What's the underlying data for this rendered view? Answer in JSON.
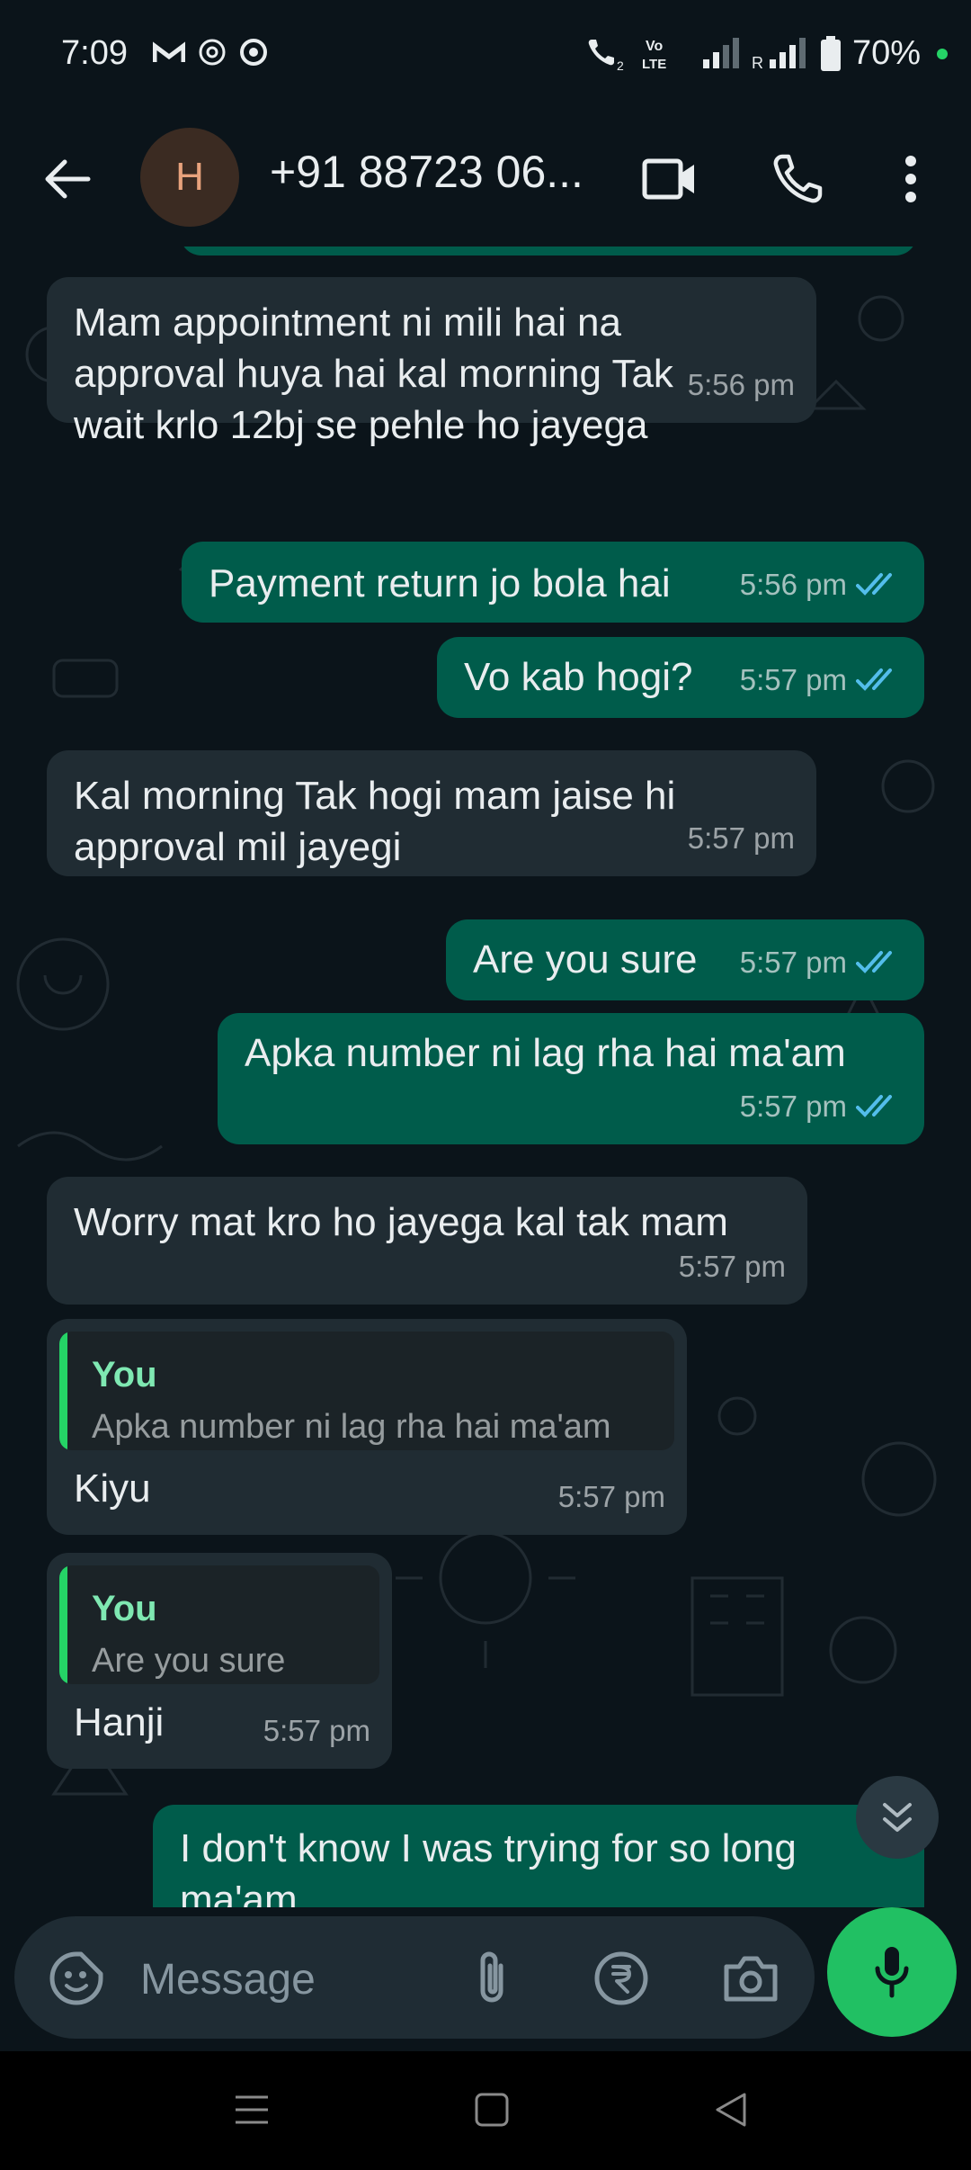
{
  "status_bar": {
    "time": "7:09",
    "battery": "70%",
    "network_label_top": "Vo",
    "network_label_bottom": "LTE",
    "roaming": "R"
  },
  "header": {
    "avatar_letter": "H",
    "contact_name": "+91 88723 06..."
  },
  "messages": [
    {
      "dir": "in",
      "text": "Mam appointment ni mili hai na\napproval huya hai kal morning Tak\nwait krlo 12bj se pehle ho jayega",
      "time": "5:56 pm"
    },
    {
      "dir": "out",
      "text": "Payment return jo bola hai",
      "time": "5:56 pm",
      "status": "read"
    },
    {
      "dir": "out",
      "text": "Vo kab hogi?",
      "time": "5:57 pm",
      "status": "read"
    },
    {
      "dir": "in",
      "text": "Kal morning Tak hogi mam jaise hi\napproval mil jayegi",
      "time": "5:57 pm"
    },
    {
      "dir": "out",
      "text": "Are you sure",
      "time": "5:57 pm",
      "status": "read"
    },
    {
      "dir": "out",
      "text": "Apka number ni lag rha hai ma'am",
      "time": "5:57 pm",
      "status": "read"
    },
    {
      "dir": "in",
      "text": "Worry mat kro ho jayega kal tak mam",
      "time": "5:57 pm"
    },
    {
      "dir": "in",
      "quote_author": "You",
      "quote_text": "Apka number ni lag rha hai ma'am",
      "text": "Kiyu",
      "time": "5:57 pm"
    },
    {
      "dir": "in",
      "quote_author": "You",
      "quote_text": "Are you sure",
      "text": "Hanji",
      "time": "5:57 pm"
    },
    {
      "dir": "out",
      "text": "I don't know I was trying for so long\nma'am",
      "time": ""
    }
  ],
  "composer": {
    "placeholder": "Message"
  },
  "colors": {
    "background": "#0b141a",
    "incoming_bubble": "#202c33",
    "outgoing_bubble": "#005c4b",
    "accent_green": "#21c063",
    "read_ticks": "#53bdeb"
  }
}
